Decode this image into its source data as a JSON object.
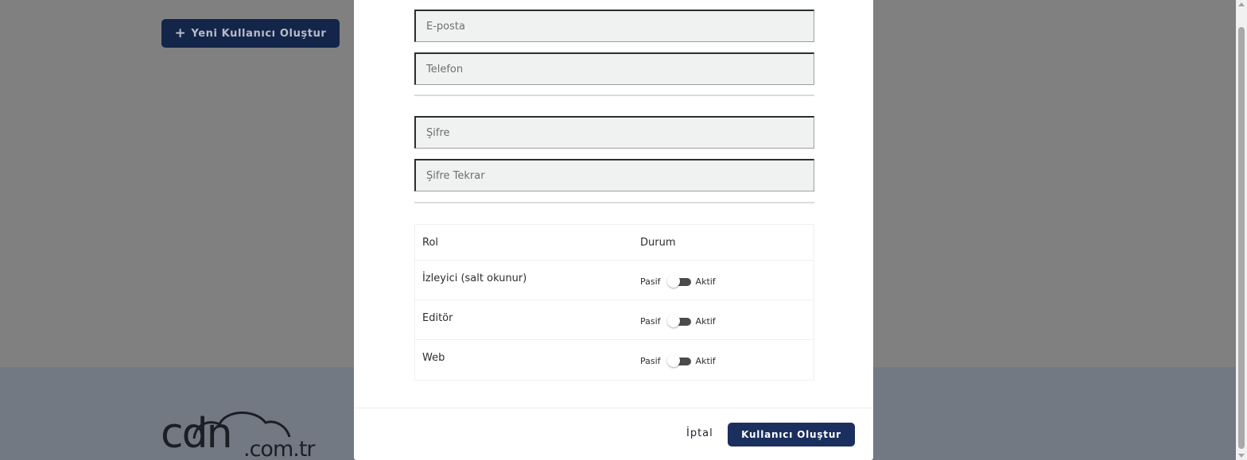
{
  "background": {
    "new_user_button": {
      "icon": "plus-icon",
      "label": "Yeni Kullanıcı Oluştur"
    },
    "logo": {
      "name": "cdn",
      "suffix": ".com.tr"
    }
  },
  "form": {
    "email_placeholder": "E-posta",
    "phone_placeholder": "Telefon",
    "password_placeholder": "Şifre",
    "password_repeat_placeholder": "Şifre Tekrar"
  },
  "roles": {
    "header": {
      "role": "Rol",
      "status": "Durum"
    },
    "items": [
      {
        "label": "İzleyici (salt okunur)",
        "off_label": "Pasif",
        "on_label": "Aktif",
        "active": false
      },
      {
        "label": "Editör",
        "off_label": "Pasif",
        "on_label": "Aktif",
        "active": false
      },
      {
        "label": "Web",
        "off_label": "Pasif",
        "on_label": "Aktif",
        "active": false
      }
    ]
  },
  "footer": {
    "cancel_label": "İptal",
    "create_label": "Kullanıcı Oluştur"
  },
  "colors": {
    "primary": "#1a2f5e",
    "overlay": "#808080"
  }
}
